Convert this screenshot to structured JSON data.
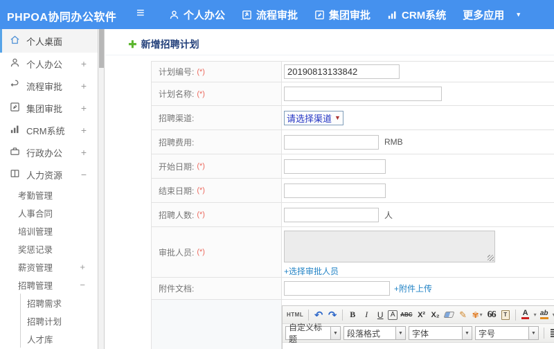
{
  "topbar": {
    "brand": "PHPOA协同办公软件",
    "menu": [
      {
        "label": "个人办公",
        "icon": "user-icon"
      },
      {
        "label": "流程审批",
        "icon": "workflow-icon"
      },
      {
        "label": "集团审批",
        "icon": "edit-icon"
      },
      {
        "label": "CRM系统",
        "icon": "bar-chart-icon"
      },
      {
        "label": "更多应用",
        "icon": "caret-down-icon"
      }
    ]
  },
  "icons": {
    "hamburger": "≡",
    "caret_down": "▼",
    "plus_badge": "✚",
    "select_arrow": "▼",
    "undo": "↶",
    "redo": "↷",
    "paste_T": "T"
  },
  "sidebar": {
    "items": [
      {
        "label": "个人桌面",
        "icon": "home-icon",
        "active": true,
        "expander": ""
      },
      {
        "label": "个人办公",
        "icon": "user-icon",
        "expander": "+"
      },
      {
        "label": "流程审批",
        "icon": "workflow-icon",
        "expander": "+"
      },
      {
        "label": "集团审批",
        "icon": "edit-icon",
        "expander": "+"
      },
      {
        "label": "CRM系统",
        "icon": "bar-chart-icon",
        "expander": "+"
      },
      {
        "label": "行政办公",
        "icon": "briefcase-icon",
        "expander": "+"
      },
      {
        "label": "人力资源",
        "icon": "book-icon",
        "expander": "−"
      }
    ],
    "subitems": [
      {
        "label": "考勤管理",
        "expander": ""
      },
      {
        "label": "人事合同",
        "expander": ""
      },
      {
        "label": "培训管理",
        "expander": ""
      },
      {
        "label": "奖惩记录",
        "expander": ""
      },
      {
        "label": "薪资管理",
        "expander": "+"
      },
      {
        "label": "招聘管理",
        "expander": "−"
      }
    ],
    "subsubitems": [
      {
        "label": "招聘需求"
      },
      {
        "label": "招聘计划"
      },
      {
        "label": "人才库"
      }
    ]
  },
  "main": {
    "title": "新增招聘计划",
    "form": {
      "rows": [
        {
          "label": "计划编号:",
          "required": "(*)",
          "value": "20190813133842"
        },
        {
          "label": "计划名称:",
          "required": "(*)",
          "value": ""
        },
        {
          "label": "招聘渠道:",
          "required": "",
          "select": "请选择渠道"
        },
        {
          "label": "招聘费用:",
          "required": "",
          "value": "",
          "suffix": "RMB"
        },
        {
          "label": "开始日期:",
          "required": "(*)",
          "value": ""
        },
        {
          "label": "结束日期:",
          "required": "(*)",
          "value": ""
        },
        {
          "label": "招聘人数:",
          "required": "(*)",
          "value": "",
          "suffix": "人"
        },
        {
          "label": "审批人员:",
          "required": "(*)",
          "link": "+选择审批人员"
        },
        {
          "label": "附件文档:",
          "required": "",
          "value": "",
          "link": "+附件上传"
        }
      ]
    },
    "editor": {
      "source_button": "HTML",
      "bold": "B",
      "italic": "I",
      "underline": "U",
      "boxed_a": "A",
      "strike": "ABC",
      "superscript": "X²",
      "subscript": "X₂",
      "quote": "66",
      "font_color": "A",
      "highlight": "ab",
      "combos": [
        {
          "label": "自定义标题"
        },
        {
          "label": "段落格式"
        },
        {
          "label": "字体"
        },
        {
          "label": "字号"
        }
      ]
    }
  },
  "colors": {
    "topbar_blue": "#4591ee",
    "active_item_border": "#57a4e8",
    "title_navy": "#25427c",
    "link_blue": "#2484c6",
    "required_red": "#ec6a5e",
    "select_text_blue": "#2335c4",
    "plus_green": "#5ab52d"
  }
}
